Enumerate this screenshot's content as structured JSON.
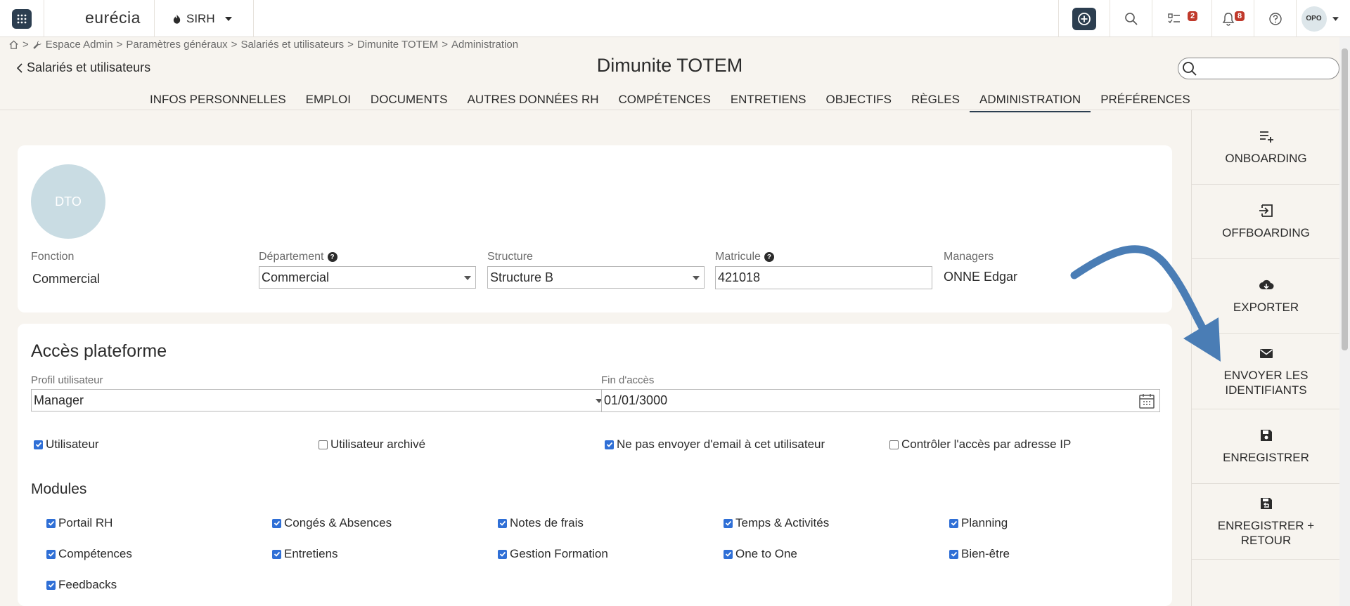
{
  "topbar": {
    "logo": "eurécia",
    "module": "SIRH",
    "tasks_count": "2",
    "notifications_count": "8",
    "user_initials": "OPO"
  },
  "breadcrumb": [
    "Espace Admin",
    "Paramètres généraux",
    "Salariés et utilisateurs",
    "Dimunite TOTEM",
    "Administration"
  ],
  "breadcrumb_sep": ">",
  "back_label": "Salariés et utilisateurs",
  "page_title": "Dimunite TOTEM",
  "search": {
    "value": ""
  },
  "tabs": [
    {
      "label": "INFOS PERSONNELLES",
      "active": false
    },
    {
      "label": "EMPLOI",
      "active": false
    },
    {
      "label": "DOCUMENTS",
      "active": false
    },
    {
      "label": "AUTRES DONNÉES RH",
      "active": false
    },
    {
      "label": "COMPÉTENCES",
      "active": false
    },
    {
      "label": "ENTRETIENS",
      "active": false
    },
    {
      "label": "OBJECTIFS",
      "active": false
    },
    {
      "label": "RÈGLES",
      "active": false
    },
    {
      "label": "ADMINISTRATION",
      "active": true
    },
    {
      "label": "PRÉFÉRENCES",
      "active": false
    }
  ],
  "actions": [
    {
      "label": "ONBOARDING",
      "icon": "list-add-icon"
    },
    {
      "label": "OFFBOARDING",
      "icon": "exit-icon"
    },
    {
      "label": "EXPORTER",
      "icon": "cloud-download-icon"
    },
    {
      "label": "ENVOYER LES\nIDENTIFIANTS",
      "icon": "envelope-icon"
    },
    {
      "label": "ENREGISTRER",
      "icon": "floppy-icon"
    },
    {
      "label": "ENREGISTRER +\nRETOUR",
      "icon": "floppy-return-icon"
    }
  ],
  "employee": {
    "avatar_initials": "DTO",
    "fonction_label": "Fonction",
    "fonction_value": "Commercial",
    "departement_label": "Département",
    "departement_value": "Commercial",
    "structure_label": "Structure",
    "structure_value": "Structure B",
    "matricule_label": "Matricule",
    "matricule_value": "421018",
    "managers_label": "Managers",
    "managers_value": "ONNE Edgar"
  },
  "access": {
    "title": "Accès plateforme",
    "profil_label": "Profil utilisateur",
    "profil_value": "Manager",
    "fin_label": "Fin d'accès",
    "fin_value": "01/01/3000",
    "options": [
      {
        "label": "Utilisateur",
        "checked": true
      },
      {
        "label": "Utilisateur archivé",
        "checked": false
      },
      {
        "label": "Ne pas envoyer d'email à cet utilisateur",
        "checked": true
      },
      {
        "label": "Contrôler l'accès par adresse IP",
        "checked": false
      }
    ]
  },
  "modules": {
    "title": "Modules",
    "items": [
      {
        "label": "Portail RH",
        "checked": true
      },
      {
        "label": "Congés & Absences",
        "checked": true
      },
      {
        "label": "Notes de frais",
        "checked": true
      },
      {
        "label": "Temps & Activités",
        "checked": true
      },
      {
        "label": "Planning",
        "checked": true
      },
      {
        "label": "Compétences",
        "checked": true
      },
      {
        "label": "Entretiens",
        "checked": true
      },
      {
        "label": "Gestion Formation",
        "checked": true
      },
      {
        "label": "One to One",
        "checked": true
      },
      {
        "label": "Bien-être",
        "checked": true
      },
      {
        "label": "Feedbacks",
        "checked": true
      }
    ]
  },
  "colors": {
    "accent": "#2c3e50",
    "badge": "#c0392b",
    "checkbox": "#2f6fd6",
    "annotation_arrow": "#4a7db5",
    "background": "#f7f4ef"
  }
}
